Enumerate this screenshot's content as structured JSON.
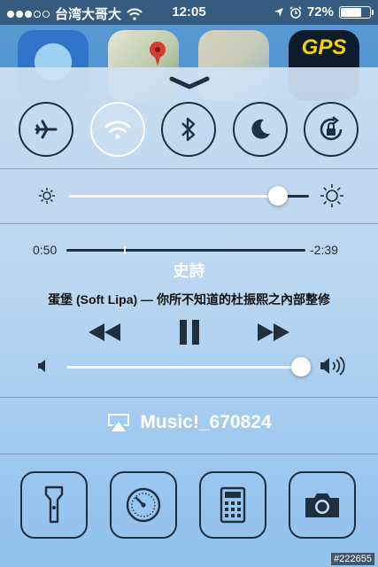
{
  "status_bar": {
    "carrier": "台湾大哥大",
    "time": "12:05",
    "battery_percent_label": "72%",
    "battery_level": 0.72,
    "signal_filled_dots": 3,
    "signal_total_dots": 5
  },
  "background_apps": {
    "gps_label": "GPS"
  },
  "toggles": [
    {
      "name": "airplane-mode",
      "icon": "airplane-icon",
      "on": false
    },
    {
      "name": "wifi",
      "icon": "wifi-icon",
      "on": true
    },
    {
      "name": "bluetooth",
      "icon": "bluetooth-icon",
      "on": false
    },
    {
      "name": "do-not-disturb",
      "icon": "moon-icon",
      "on": false
    },
    {
      "name": "rotation-lock",
      "icon": "rotation-lock-icon",
      "on": false
    }
  ],
  "brightness": {
    "level": 0.87
  },
  "music": {
    "elapsed": "0:50",
    "remaining": "-2:39",
    "progress": 0.24,
    "title": "史詩",
    "info": "蛋堡 (Soft Lipa) — 你所不知道的杜振熙之內部整修",
    "volume": 0.98
  },
  "airplay": {
    "label": "Music!_670824"
  },
  "tools": [
    {
      "name": "flashlight",
      "icon": "flashlight-icon"
    },
    {
      "name": "timer",
      "icon": "timer-icon"
    },
    {
      "name": "calculator",
      "icon": "calculator-icon"
    },
    {
      "name": "camera",
      "icon": "camera-icon"
    }
  ],
  "watermark": "#222655",
  "colors": {
    "accent_on": "#ffffff",
    "icon_dark": "#1f2f3d"
  }
}
